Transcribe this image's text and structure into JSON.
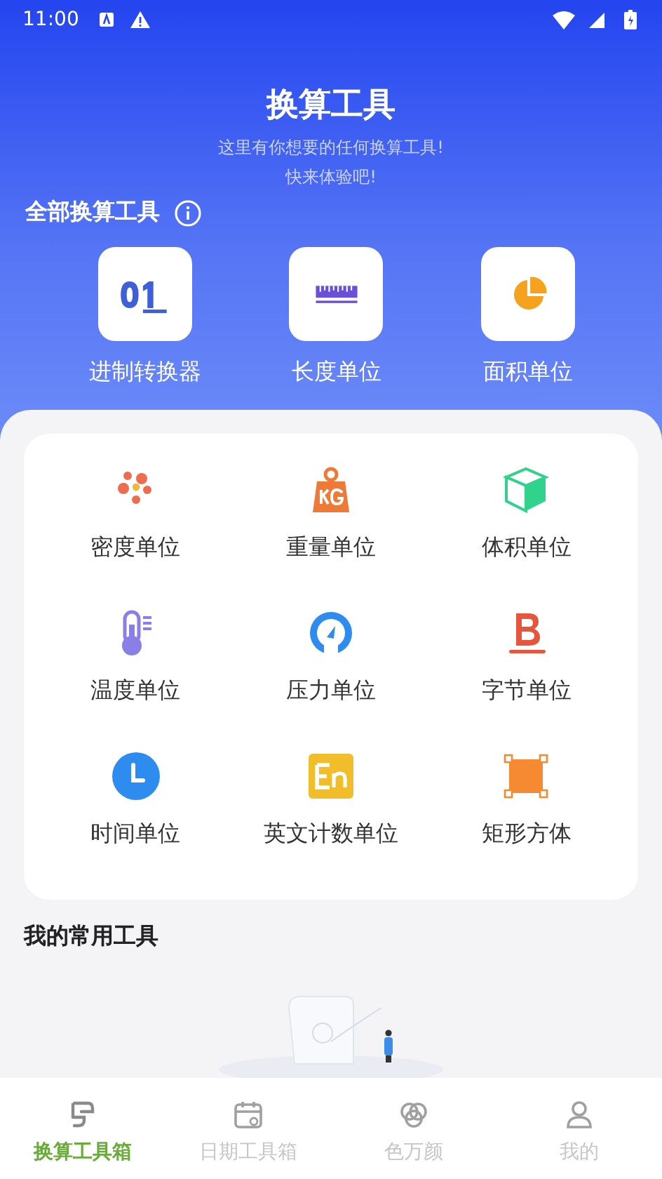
{
  "status_bar": {
    "time": "11:00"
  },
  "header": {
    "title": "换算工具",
    "subtitle": "这里有你想要的任何换算工具!\n快来体验吧!"
  },
  "section_all": {
    "title": "全部换算工具"
  },
  "featured": [
    {
      "kind": "binary",
      "label": "进制转换器"
    },
    {
      "kind": "ruler",
      "label": "长度单位"
    },
    {
      "kind": "pie",
      "label": "面积单位"
    }
  ],
  "tools": [
    {
      "kind": "dots",
      "label": "密度单位"
    },
    {
      "kind": "weight",
      "label": "重量单位"
    },
    {
      "kind": "cube",
      "label": "体积单位"
    },
    {
      "kind": "thermo",
      "label": "温度单位"
    },
    {
      "kind": "gauge",
      "label": "压力单位"
    },
    {
      "kind": "byte",
      "label": "字节单位"
    },
    {
      "kind": "clock",
      "label": "时间单位"
    },
    {
      "kind": "en",
      "label": "英文计数单位"
    },
    {
      "kind": "rect",
      "label": "矩形方体"
    }
  ],
  "section_favorites": {
    "title": "我的常用工具",
    "empty": true
  },
  "tabs": [
    {
      "kind": "convert",
      "label": "换算工具箱",
      "selected": true
    },
    {
      "kind": "calendar",
      "label": "日期工具箱",
      "selected": false
    },
    {
      "kind": "color",
      "label": "色万颜",
      "selected": false
    },
    {
      "kind": "user",
      "label": "我的",
      "selected": false
    }
  ]
}
